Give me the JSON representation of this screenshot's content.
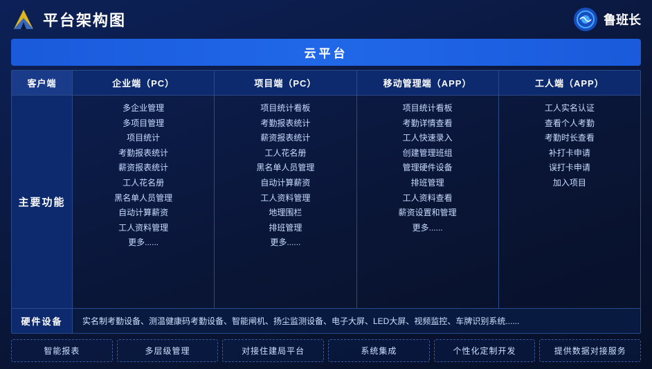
{
  "header": {
    "title": "平台架构图",
    "brand_name": "鲁班长"
  },
  "cloud_banner": "云平台",
  "col_headers": {
    "client": "客户端",
    "enterprise_pc": "企业端（PC）",
    "project_pc": "项目端（PC）",
    "mobile_app": "移动管理端（APP）",
    "worker_app": "工人端（APP）"
  },
  "main_features": {
    "row_label": "主要功能",
    "enterprise_items": [
      "多企业管理",
      "多项目管理",
      "项目统计",
      "考勤报表统计",
      "薪资报表统计",
      "工人花名册",
      "黑名单人员管理",
      "自动计算薪资",
      "工人资料管理",
      "更多......"
    ],
    "project_items": [
      "项目统计看板",
      "考勤报表统计",
      "薪资报表统计",
      "工人花名册",
      "黑名单人员管理",
      "自动计算薪资",
      "工人资料管理",
      "地理围栏",
      "排班管理",
      "更多......"
    ],
    "mobile_items": [
      "项目统计看板",
      "考勤详情查看",
      "工人快速录入",
      "创建管理班组",
      "管理硬件设备",
      "排班管理",
      "工人资料查看",
      "薪资设置和管理",
      "更多......"
    ],
    "worker_items": [
      "工人实名认证",
      "查看个人考勤",
      "考勤时长查看",
      "补打卡申请",
      "误打卡申请",
      "加入项目"
    ]
  },
  "hardware": {
    "label": "硬件设备",
    "content": "实名制考勤设备、测温健康码考勤设备、智能闸机、扬尘监测设备、电子大屏、LED大屏、视频监控、车牌识别系统......"
  },
  "features": [
    "智能报表",
    "多层级管理",
    "对接住建局平台",
    "系统集成",
    "个性化定制开发",
    "提供数据对接服务"
  ]
}
